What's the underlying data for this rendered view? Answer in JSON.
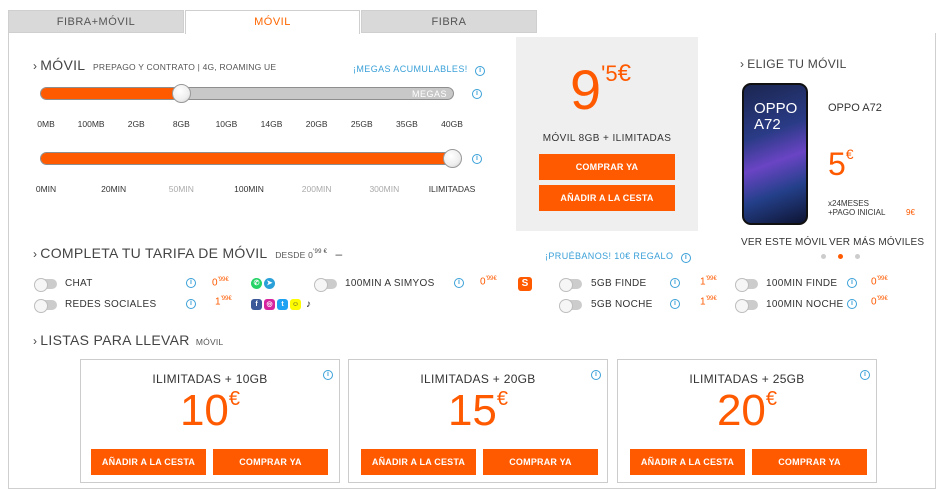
{
  "tabs": [
    {
      "label": "FIBRA+MÓVIL"
    },
    {
      "label": "MÓVIL"
    },
    {
      "label": "FIBRA"
    }
  ],
  "movil": {
    "title": "MÓVIL",
    "subtitle": "PREPAGO Y CONTRATO | 4G, ROAMING UE",
    "megas_link": "¡MEGAS ACUMULABLES!",
    "data_slider": {
      "label": "MEGAS",
      "level_index": 3,
      "ticks": [
        "0MB",
        "100MB",
        "2GB",
        "8GB",
        "10GB",
        "14GB",
        "20GB",
        "25GB",
        "35GB",
        "40GB"
      ]
    },
    "min_slider": {
      "level_fraction": 1.0,
      "ticks": [
        "0MIN",
        "20MIN",
        "50MIN",
        "100MIN",
        "200MIN",
        "300MIN",
        "ILIMITADAS"
      ],
      "dim_ticks": [
        false,
        false,
        true,
        false,
        true,
        true,
        false
      ]
    }
  },
  "price_box": {
    "integer": "9",
    "decimals": "'5",
    "currency": "€",
    "plan": "MÓVIL 8GB + ILIMITADAS",
    "buy_label": "COMPRAR YA",
    "cart_label": "AÑADIR A LA CESTA"
  },
  "phone": {
    "section_title": "ELIGE TU MÓVIL",
    "screen_text_1": "OPPO",
    "screen_text_2": "A72",
    "model": "OPPO A72",
    "price": "5",
    "currency": "€",
    "terms_1": "x24MESES",
    "terms_2": "+PAGO INICIAL",
    "initial": "9€",
    "view_label": "VER ESTE MÓVIL",
    "more_label": "VER MÁS MÓVILES",
    "active_dot": 1
  },
  "completa": {
    "title": "COMPLETA TU TARIFA DE MÓVIL",
    "desde": "DESDE 0",
    "desde_sup": "'99 €",
    "dash": "–",
    "promo": "¡PRUÉBANOS! 10€ REGALO",
    "options": [
      {
        "label": "CHAT",
        "price": "0",
        "sup": "'99€"
      },
      {
        "label": "REDES SOCIALES",
        "price": "1",
        "sup": "'99€"
      },
      {
        "label": "100MIN A SIMYOS",
        "price": "0",
        "sup": "'99€"
      },
      {
        "label": "5GB FINDE",
        "price": "1",
        "sup": "'99€"
      },
      {
        "label": "5GB NOCHE",
        "price": "1",
        "sup": "'99€"
      },
      {
        "label": "100MIN FINDE",
        "price": "0",
        "sup": "'99€"
      },
      {
        "label": "100MIN NOCHE",
        "price": "0",
        "sup": "'99€"
      }
    ]
  },
  "listas": {
    "title": "LISTAS PARA LLEVAR",
    "sub": "MÓVIL",
    "cards": [
      {
        "title": "ILIMITADAS + 10GB",
        "price": "10",
        "currency": "€",
        "cart": "AÑADIR A LA CESTA",
        "buy": "COMPRAR YA"
      },
      {
        "title": "ILIMITADAS + 20GB",
        "price": "15",
        "currency": "€",
        "cart": "AÑADIR A LA CESTA",
        "buy": "COMPRAR YA"
      },
      {
        "title": "ILIMITADAS + 25GB",
        "price": "20",
        "currency": "€",
        "cart": "AÑADIR A LA CESTA",
        "buy": "COMPRAR YA"
      }
    ]
  },
  "colors": {
    "accent": "#ff5a00",
    "info": "#3aa0d8"
  }
}
